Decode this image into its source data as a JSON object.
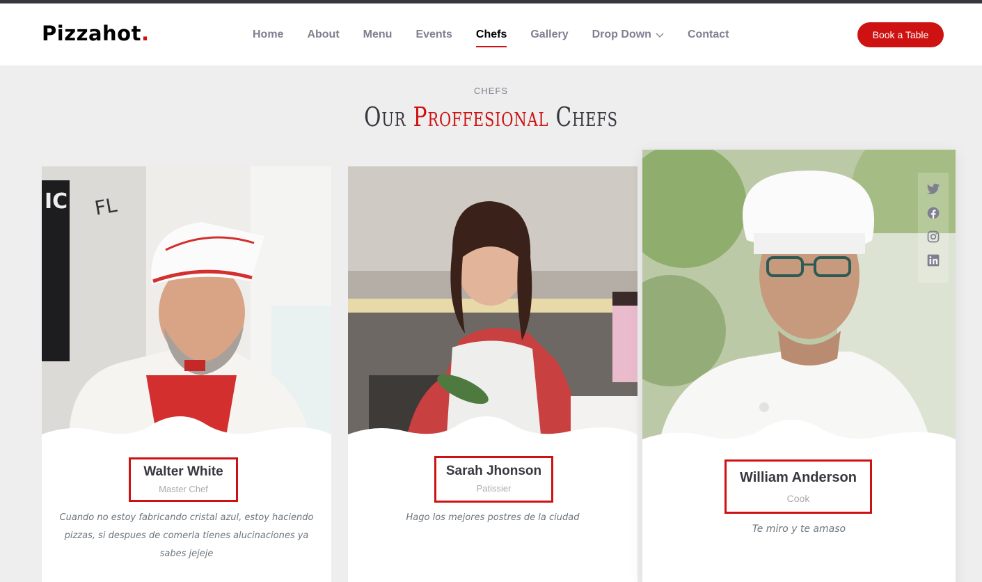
{
  "brand": {
    "name": "Pizzahot",
    "dot": "."
  },
  "nav": {
    "items": [
      "Home",
      "About",
      "Menu",
      "Events",
      "Chefs",
      "Gallery",
      "Drop Down",
      "Contact"
    ],
    "active": "Chefs"
  },
  "header": {
    "book_label": "Book a Table"
  },
  "section": {
    "subtitle": "CHEFS",
    "title_pre": "Our",
    "title_accent": "Proffesional",
    "title_post": "Chefs"
  },
  "chefs": [
    {
      "name": "Walter White",
      "role": "Master Chef",
      "quote": "Cuando no estoy fabricando cristal azul, estoy haciendo pizzas, si despues de comerla tienes alucinaciones ya sabes jejeje"
    },
    {
      "name": "Sarah Jhonson",
      "role": "Patissier",
      "quote": "Hago los mejores postres de la ciudad"
    },
    {
      "name": "William Anderson",
      "role": "Cook",
      "quote": "Te miro y te amaso"
    }
  ],
  "social_icons": [
    "twitter-icon",
    "facebook-icon",
    "instagram-icon",
    "linkedin-icon"
  ],
  "colors": {
    "accent": "#ce1212",
    "text": "#37373f",
    "muted": "#7f7f90"
  }
}
